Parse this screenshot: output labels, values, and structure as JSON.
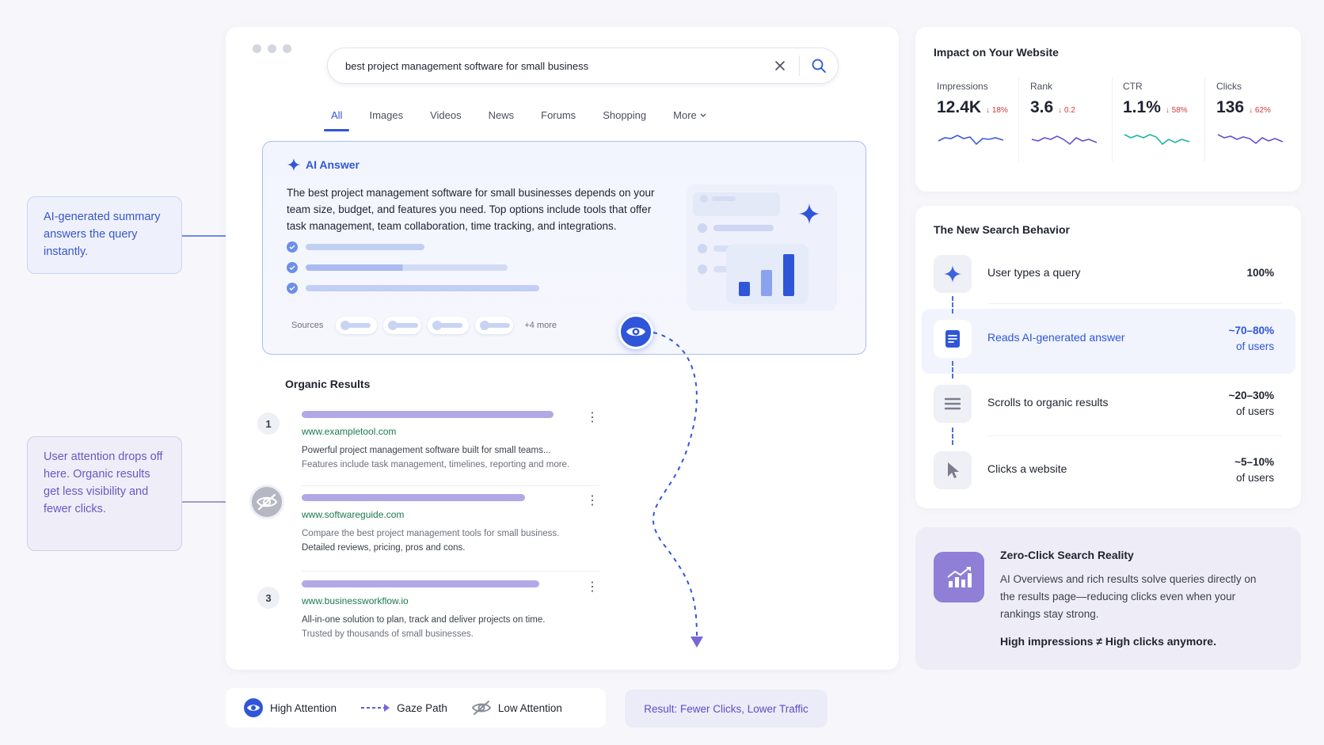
{
  "callouts": {
    "ai_summary": "AI-generated summary answers the query instantly.",
    "attention_drop": "User attention drops off here. Organic results get less visibility and fewer clicks."
  },
  "search": {
    "query": "best project management software for small business",
    "tabs": [
      {
        "label": "All",
        "active": true
      },
      {
        "label": "Images"
      },
      {
        "label": "Videos"
      },
      {
        "label": "News"
      },
      {
        "label": "Forums"
      },
      {
        "label": "Shopping"
      },
      {
        "label": "More"
      }
    ]
  },
  "ai_answer": {
    "title": "AI Answer",
    "text": "The best project management software for small businesses depends on your team size, budget, and features you need. Top options include tools that offer task management, team collaboration, time tracking, and integrations.",
    "sources_label": "Sources",
    "more_label": "+4 more"
  },
  "organic": {
    "title": "Organic Results",
    "results": [
      {
        "num": "1",
        "url": "www.exampletool.com",
        "line1": "Powerful project management software built for small teams...",
        "line2": "Features include task management, timelines, reporting and more."
      },
      {
        "num": "",
        "url": "www.softwareguide.com",
        "line1": "Compare the best project management tools for small business.",
        "line2": "Detailed reviews, pricing, pros and cons."
      },
      {
        "num": "3",
        "url": "www.businessworkflow.io",
        "line1": "All-in-one solution to plan, track and deliver projects on time.",
        "line2": "Trusted by thousands of small businesses."
      }
    ]
  },
  "legend": {
    "high": "High Attention",
    "gaze": "Gaze Path",
    "low": "Low Attention",
    "result": "Result: Fewer Clicks, Lower Traffic"
  },
  "impact": {
    "title": "Impact on Your Website",
    "metrics": [
      {
        "label": "Impressions",
        "value": "12.4K",
        "change": "↓ 18%",
        "color": "#3b5bd9"
      },
      {
        "label": "Rank",
        "value": "3.6",
        "change": "↓ 0.2",
        "color": "#6b4fd0"
      },
      {
        "label": "CTR",
        "value": "1.1%",
        "change": "↓ 58%",
        "color": "#1fb5a8"
      },
      {
        "label": "Clicks",
        "value": "136",
        "change": "↓ 62%",
        "color": "#6b4fd0"
      }
    ]
  },
  "behavior": {
    "title": "The New Search Behavior",
    "steps": [
      {
        "label": "User types a query",
        "stat": "100%",
        "sub": "",
        "icon": "sparkle-icon"
      },
      {
        "label": "Reads AI-generated answer",
        "stat": "~70–80%",
        "sub": "of users",
        "icon": "document-icon"
      },
      {
        "label": "Scrolls to organic results",
        "stat": "~20–30%",
        "sub": "of users",
        "icon": "list-icon"
      },
      {
        "label": "Clicks a website",
        "stat": "~5–10%",
        "sub": "of users",
        "icon": "cursor-icon"
      }
    ]
  },
  "zero_click": {
    "title": "Zero-Click Search Reality",
    "body": "AI Overviews and rich results solve queries directly on the results page—reducing clicks even when your rankings stay strong.",
    "highlight": "High impressions ≠ High clicks anymore."
  },
  "colors": {
    "accent": "#2f56d9",
    "purple": "#8f7fd6",
    "down": "#d63a3a"
  }
}
